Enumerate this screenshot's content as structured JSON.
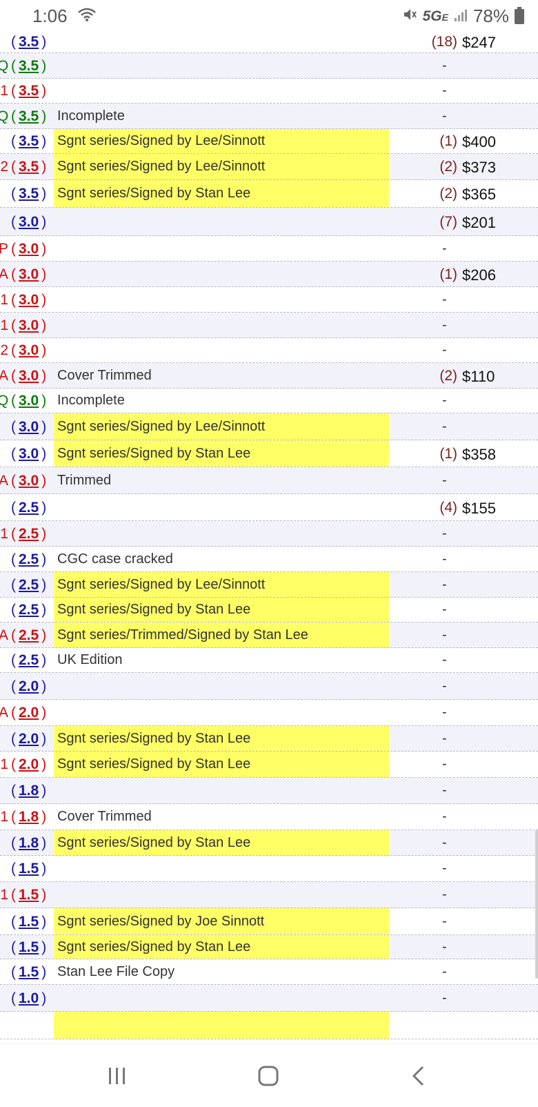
{
  "status": {
    "time": "1:06",
    "network": "5G",
    "network_sub": "E",
    "battery": "78%"
  },
  "rows": [
    {
      "prefix": "",
      "grade": "3.5",
      "color": "blue",
      "note": "",
      "hl": false,
      "count": "(18)",
      "price": "$247"
    },
    {
      "prefix": "Q",
      "grade": "3.5",
      "color": "green",
      "note": "",
      "hl": false,
      "count": "",
      "price": "-"
    },
    {
      "prefix": "1",
      "grade": "3.5",
      "color": "red",
      "note": "",
      "hl": false,
      "count": "",
      "price": "-"
    },
    {
      "prefix": "Q",
      "grade": "3.5",
      "color": "green",
      "note": "Incomplete",
      "hl": false,
      "count": "",
      "price": "-"
    },
    {
      "prefix": "",
      "grade": "3.5",
      "color": "blue",
      "note": "Sgnt series/Signed by Lee/Sinnott",
      "hl": true,
      "count": "(1)",
      "price": "$400"
    },
    {
      "prefix": "2",
      "grade": "3.5",
      "color": "red",
      "note": "Sgnt series/Signed by Lee/Sinnott",
      "hl": true,
      "count": "(2)",
      "price": "$373"
    },
    {
      "prefix": "",
      "grade": "3.5",
      "color": "blue",
      "note": "Sgnt series/Signed by Stan Lee",
      "hl": true,
      "count": "(2)",
      "price": "$365"
    },
    {
      "prefix": "",
      "grade": "3.0",
      "color": "blue",
      "note": "",
      "hl": false,
      "count": "(7)",
      "price": "$201"
    },
    {
      "prefix": "P",
      "grade": "3.0",
      "color": "red",
      "note": "",
      "hl": false,
      "count": "",
      "price": "-"
    },
    {
      "prefix": "A",
      "grade": "3.0",
      "color": "red",
      "note": "",
      "hl": false,
      "count": "(1)",
      "price": "$206"
    },
    {
      "prefix": "1",
      "grade": "3.0",
      "color": "red",
      "note": "",
      "hl": false,
      "count": "",
      "price": "-"
    },
    {
      "prefix": "1",
      "grade": "3.0",
      "color": "red",
      "note": "",
      "hl": false,
      "count": "",
      "price": "-"
    },
    {
      "prefix": "2",
      "grade": "3.0",
      "color": "red",
      "note": "",
      "hl": false,
      "count": "",
      "price": "-"
    },
    {
      "prefix": "A",
      "grade": "3.0",
      "color": "red",
      "note": "Cover Trimmed",
      "hl": false,
      "count": "(2)",
      "price": "$110"
    },
    {
      "prefix": "Q",
      "grade": "3.0",
      "color": "green",
      "note": "Incomplete",
      "hl": false,
      "count": "",
      "price": "-"
    },
    {
      "prefix": "",
      "grade": "3.0",
      "color": "blue",
      "note": "Sgnt series/Signed by Lee/Sinnott",
      "hl": true,
      "count": "",
      "price": "-"
    },
    {
      "prefix": "",
      "grade": "3.0",
      "color": "blue",
      "note": "Sgnt series/Signed by Stan Lee",
      "hl": true,
      "count": "(1)",
      "price": "$358"
    },
    {
      "prefix": "A",
      "grade": "3.0",
      "color": "red",
      "note": "Trimmed",
      "hl": false,
      "count": "",
      "price": "-"
    },
    {
      "prefix": "",
      "grade": "2.5",
      "color": "blue",
      "note": "",
      "hl": false,
      "count": "(4)",
      "price": "$155"
    },
    {
      "prefix": "1",
      "grade": "2.5",
      "color": "red",
      "note": "",
      "hl": false,
      "count": "",
      "price": "-"
    },
    {
      "prefix": "",
      "grade": "2.5",
      "color": "blue",
      "note": "CGC case cracked",
      "hl": false,
      "count": "",
      "price": "-"
    },
    {
      "prefix": "",
      "grade": "2.5",
      "color": "blue",
      "note": "Sgnt series/Signed by Lee/Sinnott",
      "hl": true,
      "count": "",
      "price": "-"
    },
    {
      "prefix": "",
      "grade": "2.5",
      "color": "blue",
      "note": "Sgnt series/Signed by Stan Lee",
      "hl": true,
      "count": "",
      "price": "-"
    },
    {
      "prefix": "A",
      "grade": "2.5",
      "color": "red",
      "note": "Sgnt series/Trimmed/Signed by Stan Lee",
      "hl": true,
      "count": "",
      "price": "-"
    },
    {
      "prefix": "",
      "grade": "2.5",
      "color": "blue",
      "note": "UK Edition",
      "hl": false,
      "count": "",
      "price": "-"
    },
    {
      "prefix": "",
      "grade": "2.0",
      "color": "blue",
      "note": "",
      "hl": false,
      "count": "",
      "price": "-"
    },
    {
      "prefix": "A",
      "grade": "2.0",
      "color": "red",
      "note": "",
      "hl": false,
      "count": "",
      "price": "-"
    },
    {
      "prefix": "",
      "grade": "2.0",
      "color": "blue",
      "note": "Sgnt series/Signed by Stan Lee",
      "hl": true,
      "count": "",
      "price": "-"
    },
    {
      "prefix": "1",
      "grade": "2.0",
      "color": "red",
      "note": "Sgnt series/Signed by Stan Lee",
      "hl": true,
      "count": "",
      "price": "-"
    },
    {
      "prefix": "",
      "grade": "1.8",
      "color": "blue",
      "note": "",
      "hl": false,
      "count": "",
      "price": "-"
    },
    {
      "prefix": "1",
      "grade": "1.8",
      "color": "red",
      "note": "Cover Trimmed",
      "hl": false,
      "count": "",
      "price": "-"
    },
    {
      "prefix": "",
      "grade": "1.8",
      "color": "blue",
      "note": "Sgnt series/Signed by Stan Lee",
      "hl": true,
      "count": "",
      "price": "-"
    },
    {
      "prefix": "",
      "grade": "1.5",
      "color": "blue",
      "note": "",
      "hl": false,
      "count": "",
      "price": "-"
    },
    {
      "prefix": "1",
      "grade": "1.5",
      "color": "red",
      "note": "",
      "hl": false,
      "count": "",
      "price": "-"
    },
    {
      "prefix": "",
      "grade": "1.5",
      "color": "blue",
      "note": "Sgnt series/Signed by Joe Sinnott",
      "hl": true,
      "count": "",
      "price": "-"
    },
    {
      "prefix": "",
      "grade": "1.5",
      "color": "blue",
      "note": "Sgnt series/Signed by Stan Lee",
      "hl": true,
      "count": "",
      "price": "-"
    },
    {
      "prefix": "",
      "grade": "1.5",
      "color": "blue",
      "note": "Stan Lee File Copy",
      "hl": false,
      "count": "",
      "price": "-"
    },
    {
      "prefix": "",
      "grade": "1.0",
      "color": "blue",
      "note": "",
      "hl": false,
      "count": "",
      "price": "-"
    },
    {
      "prefix": "",
      "grade": "",
      "color": "blue",
      "note": "",
      "hl": true,
      "count": "",
      "price": ""
    }
  ],
  "navbar": {
    "recents": "recents-icon",
    "home": "home-icon",
    "back": "back-icon"
  }
}
